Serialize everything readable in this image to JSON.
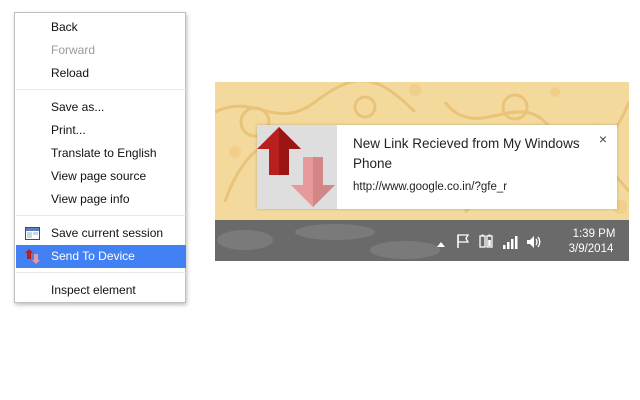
{
  "context_menu": {
    "items": [
      {
        "label": "Back",
        "state": "normal"
      },
      {
        "label": "Forward",
        "state": "disabled"
      },
      {
        "label": "Reload",
        "state": "normal"
      },
      {
        "label": "Save as...",
        "state": "normal"
      },
      {
        "label": "Print...",
        "state": "normal"
      },
      {
        "label": "Translate to English",
        "state": "normal"
      },
      {
        "label": "View page source",
        "state": "normal"
      },
      {
        "label": "View page info",
        "state": "normal"
      },
      {
        "label": "Save current session",
        "state": "normal",
        "icon": "session-window-icon"
      },
      {
        "label": "Send To Device",
        "state": "selected",
        "icon": "send-to-device-icon"
      },
      {
        "label": "Inspect element",
        "state": "normal"
      }
    ],
    "selected_color": "#4281f4"
  },
  "notification": {
    "title": "New Link Recieved from My Windows Phone",
    "url": "http://www.google.co.in/?gfe_r",
    "close_symbol": "×",
    "icon": "up-down-arrows-icon",
    "colors": {
      "up_arrow": "#b82020",
      "down_arrow": "#e69a9a",
      "wallpaper": "#f3d99c"
    }
  },
  "taskbar": {
    "tray_icons": [
      "chevron-up-icon",
      "flag-icon",
      "battery-icon",
      "signal-icon",
      "volume-icon"
    ],
    "time": "1:39 PM",
    "date": "3/9/2014"
  }
}
